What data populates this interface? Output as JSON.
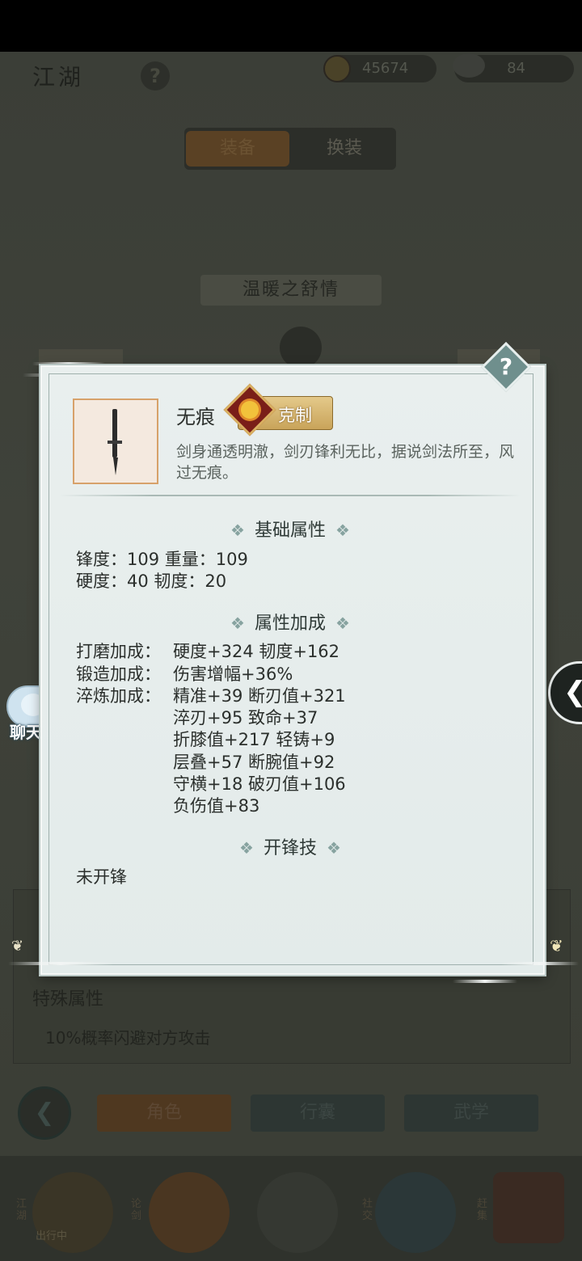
{
  "header": {
    "logo_text": "江湖",
    "help_glyph": "?",
    "coins": "45674",
    "silver": "84"
  },
  "tabs": [
    {
      "label": "装备",
      "active": true
    },
    {
      "label": "换装",
      "active": false
    }
  ],
  "character_name": "温暖之舒情",
  "special": {
    "title": "特殊属性",
    "text": "10%概率闪避对方攻击"
  },
  "bottom_buttons": [
    "角色",
    "行囊",
    "武学"
  ],
  "nav": {
    "labels": [
      "江湖",
      "论剑",
      "社交",
      "赶集"
    ],
    "outing_label": "出行中"
  },
  "chat": {
    "label": "聊天"
  },
  "modal": {
    "help_glyph": "?",
    "item_name": "无痕",
    "badge_label": "克制",
    "description": "剑身通透明澈，剑刃锋利无比，据说剑法所至，风过无痕。",
    "base_title": "基础属性",
    "base_rows": [
      "锋度：109  重量：109",
      "硬度：40  韧度：20"
    ],
    "bonus_title": "属性加成",
    "bonus_rows": [
      {
        "label": "打磨加成：",
        "lines": [
          "硬度+324  韧度+162"
        ]
      },
      {
        "label": "锻造加成：",
        "lines": [
          "伤害增幅+36%"
        ]
      },
      {
        "label": "淬炼加成：",
        "lines": [
          "精准+39  断刃值+321",
          "淬刃+95  致命+37",
          "折膝值+217  轻铸+9",
          "层叠+57  断腕值+92",
          "守横+18  破刃值+106",
          "负伤值+83"
        ]
      }
    ],
    "skill_title": "开锋技",
    "skill_text": "未开锋",
    "diamond": "❖"
  }
}
